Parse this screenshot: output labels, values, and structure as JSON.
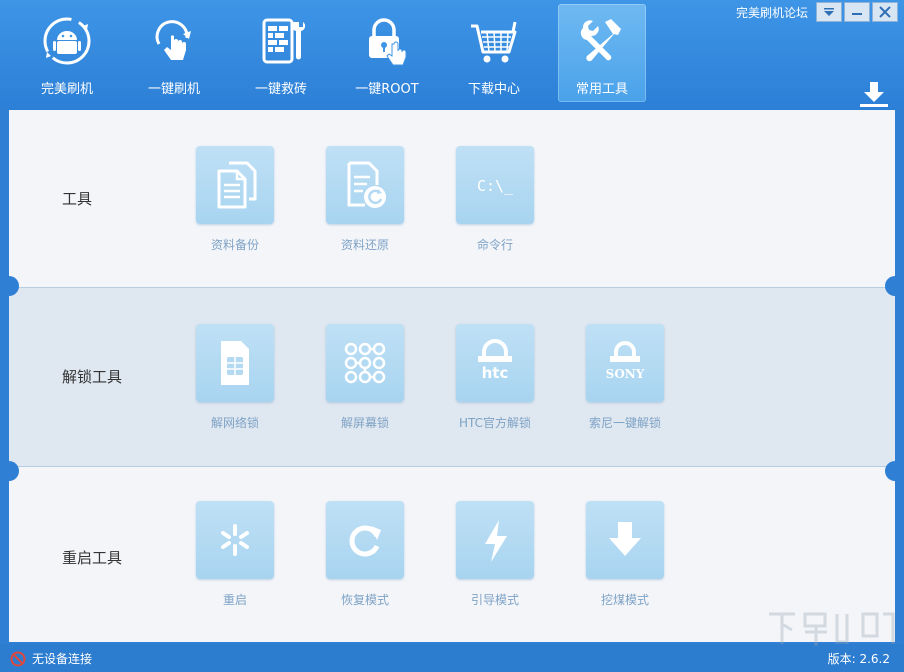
{
  "window": {
    "forum_link": "完美刷机论坛"
  },
  "nav": [
    {
      "label": "完美刷机",
      "icon": "android-refresh-icon"
    },
    {
      "label": "一键刷机",
      "icon": "touch-refresh-icon"
    },
    {
      "label": "一键救砖",
      "icon": "brick-wrench-icon"
    },
    {
      "label": "一键ROOT",
      "icon": "lock-touch-icon"
    },
    {
      "label": "下载中心",
      "icon": "cart-icon"
    },
    {
      "label": "常用工具",
      "icon": "tools-icon",
      "active": true
    }
  ],
  "sections": [
    {
      "title": "工具",
      "tools": [
        {
          "label": "资料备份",
          "icon": "backup-docs-icon"
        },
        {
          "label": "资料还原",
          "icon": "restore-doc-icon"
        },
        {
          "label": "命令行",
          "icon": "command-line-icon",
          "glyph": "C:\\_"
        }
      ]
    },
    {
      "title": "解锁工具",
      "tools": [
        {
          "label": "解网络锁",
          "icon": "sim-card-icon"
        },
        {
          "label": "解屏幕锁",
          "icon": "pattern-lock-icon"
        },
        {
          "label": "HTC官方解锁",
          "icon": "htc-lock-icon",
          "glyph": "htc"
        },
        {
          "label": "索尼一键解锁",
          "icon": "sony-lock-icon",
          "glyph": "SONY"
        }
      ]
    },
    {
      "title": "重启工具",
      "tools": [
        {
          "label": "重启",
          "icon": "spark-icon"
        },
        {
          "label": "恢复模式",
          "icon": "refresh-icon"
        },
        {
          "label": "引导模式",
          "icon": "lightning-icon"
        },
        {
          "label": "挖煤模式",
          "icon": "arrow-down-icon"
        }
      ]
    }
  ],
  "status": {
    "connection": "无设备连接",
    "version": "版本: 2.6.2"
  },
  "colors": {
    "accent": "#2f7fd4",
    "tile": "#b3daf2",
    "label": "#7fa3c6"
  }
}
